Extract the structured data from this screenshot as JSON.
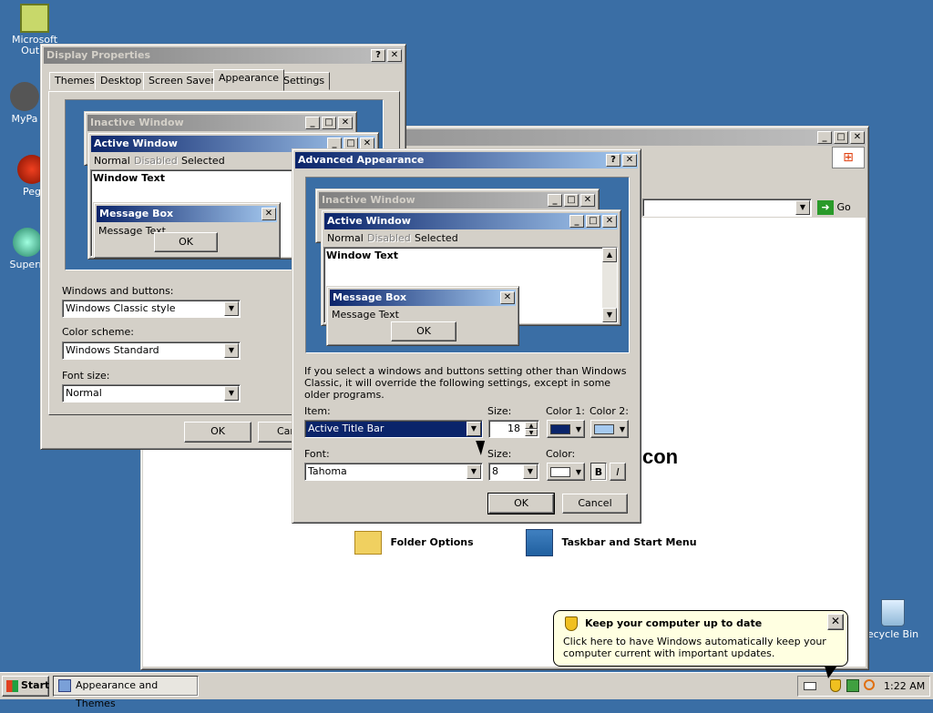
{
  "desktop": {
    "icons": [
      {
        "label": "Microsoft Outlo"
      },
      {
        "label": "MyPa"
      },
      {
        "label": "Peg"
      },
      {
        "label": "Supern"
      },
      {
        "label": "ecycle Bin"
      }
    ]
  },
  "background_window": {
    "address_go": "Go",
    "partial_heading": "con",
    "items": [
      {
        "label": "Folder Options"
      },
      {
        "label": "Taskbar and Start Menu"
      }
    ]
  },
  "display_properties": {
    "title": "Display Properties",
    "tabs": [
      "Themes",
      "Desktop",
      "Screen Saver",
      "Appearance",
      "Settings"
    ],
    "selected_tab": "Appearance",
    "preview": {
      "inactive_title": "Inactive Window",
      "active_title": "Active Window",
      "menu": {
        "normal": "Normal",
        "disabled": "Disabled",
        "selected": "Selected"
      },
      "window_text": "Window Text",
      "msgbox_title": "Message Box",
      "msgbox_text": "Message Text",
      "msgbox_ok": "OK"
    },
    "windows_buttons_label": "Windows and buttons:",
    "windows_buttons_value": "Windows Classic style",
    "color_scheme_label": "Color scheme:",
    "color_scheme_value": "Windows Standard",
    "font_size_label": "Font size:",
    "font_size_value": "Normal",
    "ok": "OK",
    "cancel": "Car"
  },
  "advanced_appearance": {
    "title": "Advanced Appearance",
    "preview": {
      "inactive_title": "Inactive Window",
      "active_title": "Active Window",
      "menu": {
        "normal": "Normal",
        "disabled": "Disabled",
        "selected": "Selected"
      },
      "window_text": "Window Text",
      "msgbox_title": "Message Box",
      "msgbox_text": "Message Text",
      "msgbox_ok": "OK"
    },
    "info": "If you select a windows and buttons setting other than Windows Classic, it will override the following settings, except in some older programs.",
    "item_label": "Item:",
    "item_value": "Active Title Bar",
    "size_label": "Size:",
    "size_value": "18",
    "color1_label": "Color 1:",
    "color1_value": "#0a246a",
    "color2_label": "Color 2:",
    "color2_value": "#a6caf0",
    "font_label": "Font:",
    "font_value": "Tahoma",
    "font_size_label": "Size:",
    "font_size_value": "8",
    "font_color_label": "Color:",
    "font_color_value": "#ffffff",
    "bold": "B",
    "italic": "I",
    "ok": "OK",
    "cancel": "Cancel"
  },
  "balloon": {
    "title": "Keep your computer up to date",
    "text": "Click here to have Windows automatically keep your computer current with important updates."
  },
  "taskbar": {
    "start": "Start",
    "task": "Appearance and Themes",
    "clock": "1:22 AM"
  },
  "colors": {
    "desktop": "#3a6ea5",
    "title_active_start": "#0a246a",
    "title_active_end": "#a6caf0",
    "face": "#d4d0c8"
  }
}
